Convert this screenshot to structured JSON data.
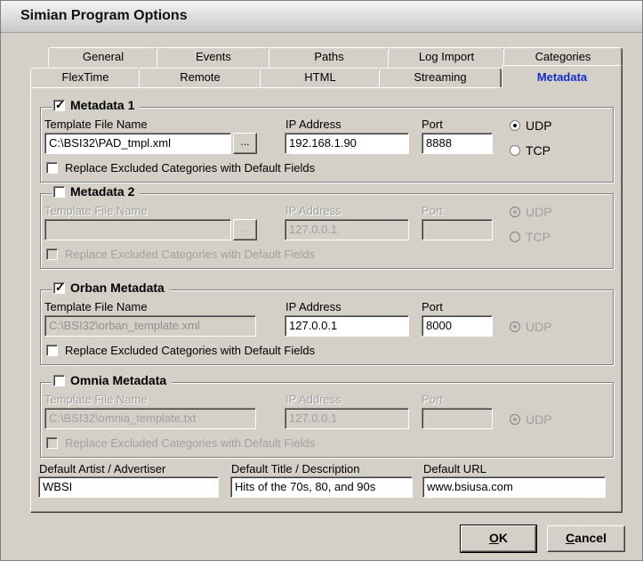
{
  "window": {
    "title": "Simian Program Options"
  },
  "tabs_row1": [
    "General",
    "Events",
    "Paths",
    "Log Import",
    "Categories"
  ],
  "tabs_row2": [
    "FlexTime",
    "Remote",
    "HTML",
    "Streaming",
    "Metadata"
  ],
  "labels": {
    "template": "Template File Name",
    "ip": "IP Address",
    "port": "Port",
    "udp": "UDP",
    "tcp": "TCP",
    "replace": "Replace Excluded Categories with Default Fields",
    "browse": "..."
  },
  "metadata1": {
    "title": "Metadata 1",
    "template": "C:\\BSI32\\PAD_tmpl.xml",
    "ip": "192.168.1.90",
    "port": "8888"
  },
  "metadata2": {
    "title": "Metadata 2",
    "template": "",
    "ip": "127.0.0.1",
    "port": ""
  },
  "orban": {
    "title": "Orban Metadata",
    "template": "C:\\BSI32\\orban_template.xml",
    "ip": "127.0.0.1",
    "port": "8000"
  },
  "omnia": {
    "title": "Omnia Metadata",
    "template": "C:\\BSI32\\omnia_template.txt",
    "ip": "127.0.0.1",
    "port": ""
  },
  "defaults": {
    "artist_label": "Default Artist / Advertiser",
    "artist_value": "WBSI",
    "title_label": "Default Title / Description",
    "title_value": "Hits of the 70s, 80, and 90s",
    "url_label": "Default URL",
    "url_value": "www.bsiusa.com"
  },
  "buttons": {
    "ok_mnemonic": "O",
    "ok_rest": "K",
    "cancel_mnemonic": "C",
    "cancel_rest": "ancel"
  }
}
